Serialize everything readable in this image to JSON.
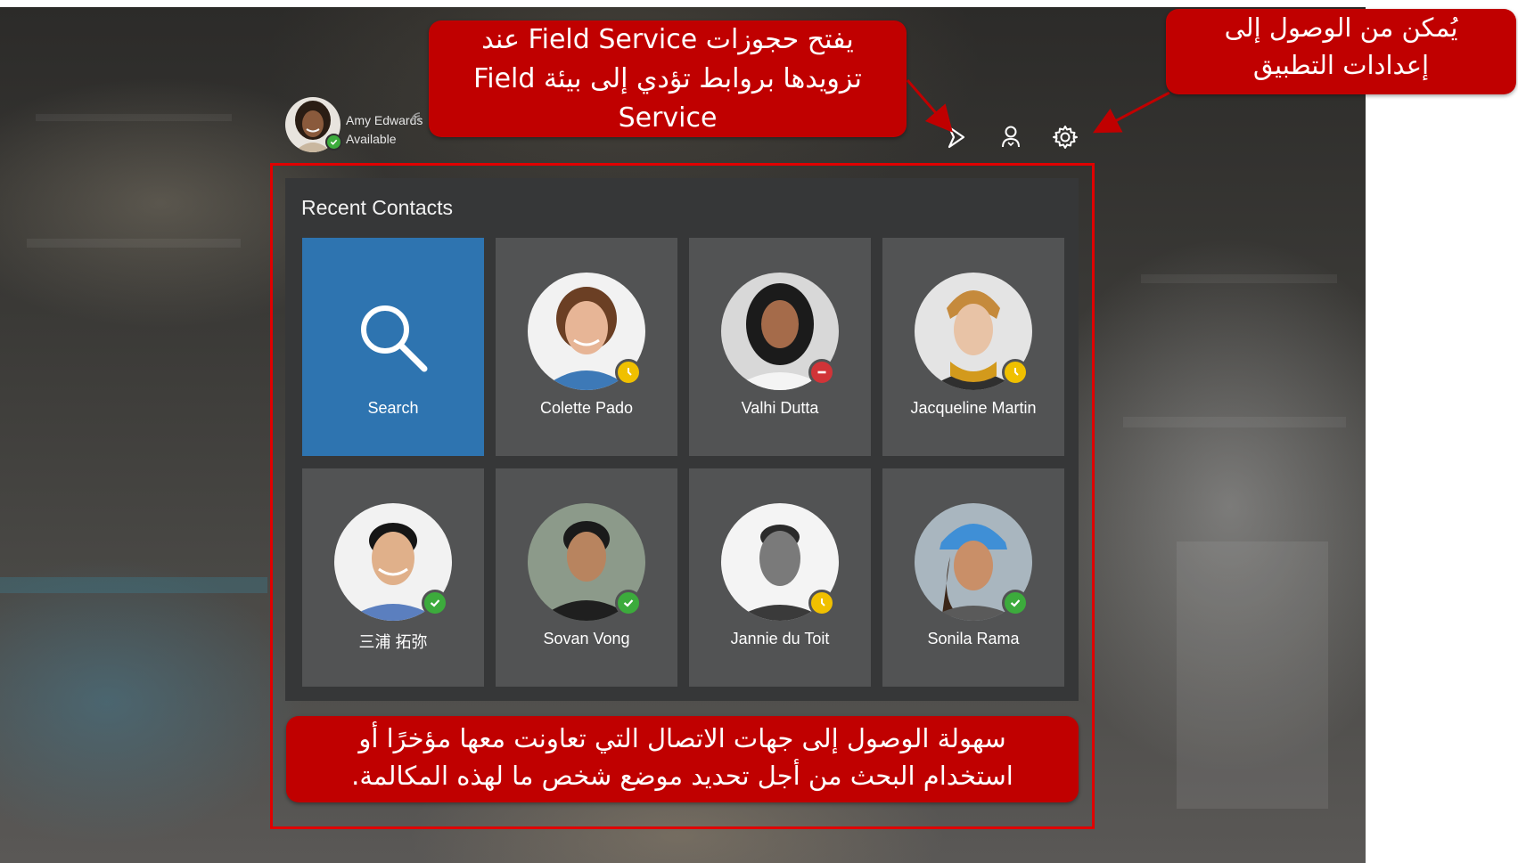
{
  "user": {
    "name": "Amy Edwards",
    "status": "Available"
  },
  "toolbar": {
    "icons": [
      "dynamics-icon",
      "contact-icon",
      "gear-icon"
    ]
  },
  "panel": {
    "title": "Recent Contacts",
    "tiles": [
      {
        "label": "Search",
        "icon": "search-icon"
      },
      {
        "label": "Colette Pado",
        "presence": "away"
      },
      {
        "label": "Valhi Dutta",
        "presence": "busy"
      },
      {
        "label": "Jacqueline Martin",
        "presence": "away"
      },
      {
        "label": "三浦 拓弥",
        "presence": "available"
      },
      {
        "label": "Sovan Vong",
        "presence": "available"
      },
      {
        "label": "Jannie du Toit",
        "presence": "away"
      },
      {
        "label": "Sonila Rama",
        "presence": "available"
      }
    ]
  },
  "callouts": {
    "field_service_line1": "يفتح حجوزات Field Service عند",
    "field_service_line2": "تزويدها بروابط تؤدي إلى بيئة Field",
    "field_service_line3": "Service",
    "settings_line1": "يُمكن من الوصول إلى",
    "settings_line2": "إعدادات التطبيق",
    "contacts_line1": "سهولة الوصول إلى جهات الاتصال التي تعاونت معها مؤخرًا أو",
    "contacts_line2": "استخدام البحث من أجل تحديد موضع شخص ما لهذه المكالمة."
  },
  "colors": {
    "callout": "#c00000",
    "search_tile": "#2e74b0",
    "tile": "#525354",
    "panel": "#363738",
    "available": "#3cab3c",
    "away": "#f0c000",
    "busy": "#d13438"
  }
}
